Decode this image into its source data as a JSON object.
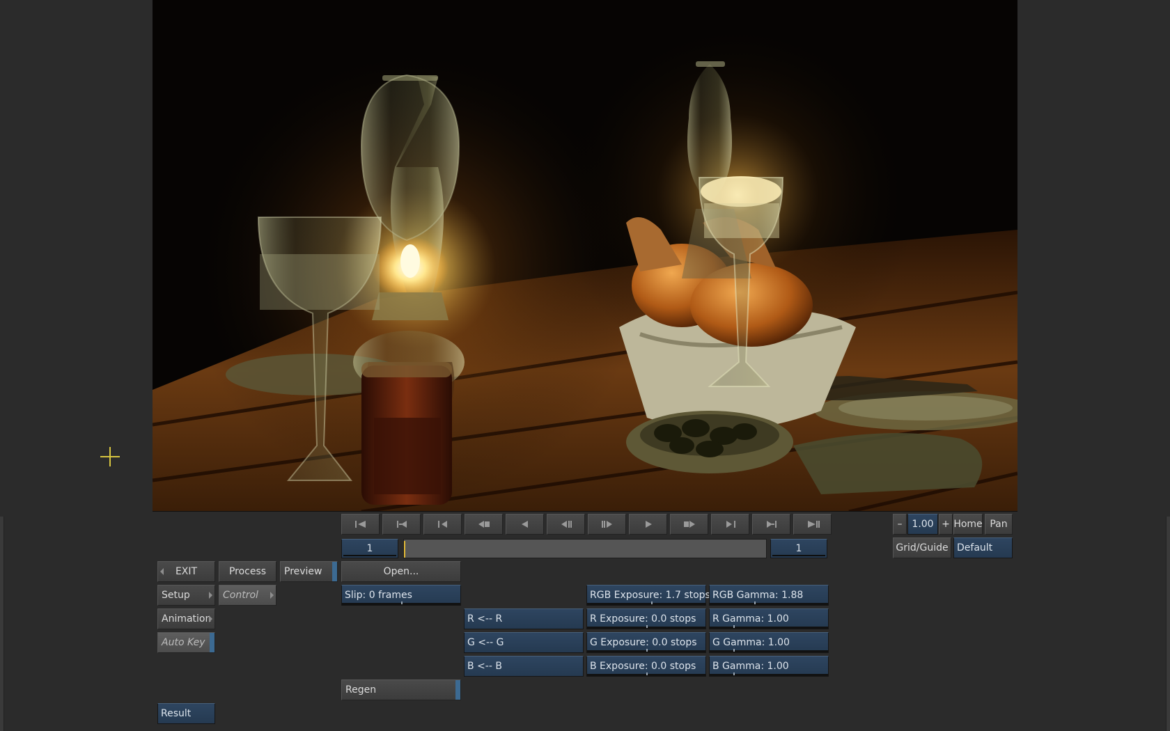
{
  "menu": {
    "exit": "EXIT",
    "process": "Process",
    "preview": "Preview",
    "setup": "Setup",
    "control": "Control",
    "animation": "Animation",
    "auto_key": "Auto Key",
    "result": "Result"
  },
  "transport": {
    "start_frame": "1",
    "end_frame": "1",
    "buttons": [
      "go-to-start",
      "previous-keyframe",
      "previous-mark",
      "rewind",
      "play-reverse",
      "step-back",
      "step-forward",
      "play",
      "fast-forward",
      "next-mark",
      "next-keyframe",
      "go-to-end"
    ]
  },
  "viewer": {
    "zoom": "1.00",
    "zoom_minus": "–",
    "zoom_plus": "+",
    "home": "Home",
    "pan": "Pan",
    "grid_guide": "Grid/Guide",
    "grid_preset": "Default"
  },
  "controls": {
    "open": "Open...",
    "slip": "Slip: 0 frames",
    "regen": "Regen",
    "r_channel": "R <-- R",
    "g_channel": "G <-- G",
    "b_channel": "B <-- B",
    "rgb_exposure": "RGB Exposure: 1.7 stops",
    "r_exposure": "R Exposure: 0.0 stops",
    "g_exposure": "G Exposure: 0.0 stops",
    "b_exposure": "B Exposure: 0.0 stops",
    "rgb_gamma": "RGB Gamma: 1.88",
    "r_gamma": "R Gamma: 1.00",
    "g_gamma": "G Gamma: 1.00",
    "b_gamma": "B Gamma: 1.00"
  },
  "colors": {
    "field_blue": "#2b4058",
    "button_gray": "#444444",
    "background": "#2b2b2b",
    "playhead": "#e0b838",
    "cursor": "#d8c640"
  }
}
